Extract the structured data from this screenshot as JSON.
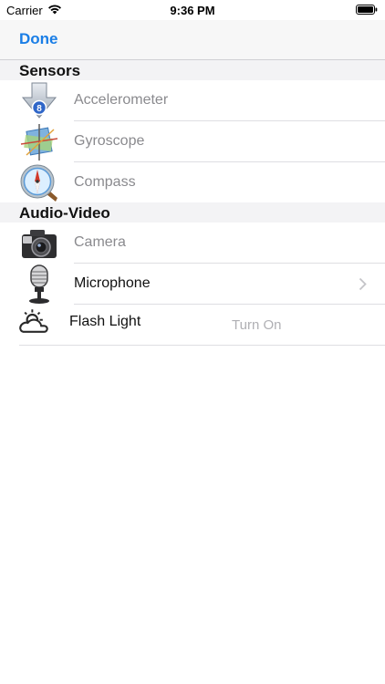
{
  "status_bar": {
    "carrier": "Carrier",
    "time": "9:36 PM"
  },
  "nav": {
    "done_label": "Done"
  },
  "sections": {
    "sensors": {
      "title": "Sensors",
      "items": [
        {
          "label": "Accelerometer",
          "icon": "accelerometer-icon"
        },
        {
          "label": "Gyroscope",
          "icon": "gyroscope-icon"
        },
        {
          "label": "Compass",
          "icon": "compass-icon"
        }
      ]
    },
    "audio_video": {
      "title": "Audio-Video",
      "items": [
        {
          "label": "Camera",
          "icon": "camera-icon"
        },
        {
          "label": "Microphone",
          "icon": "microphone-icon"
        },
        {
          "label": "Flash Light",
          "icon": "flashlight-icon",
          "action": "Turn On"
        }
      ]
    }
  },
  "colors": {
    "accent": "#1a7ee6",
    "disabled_text": "#8a8a8e",
    "section_bg": "#f3f3f5"
  }
}
